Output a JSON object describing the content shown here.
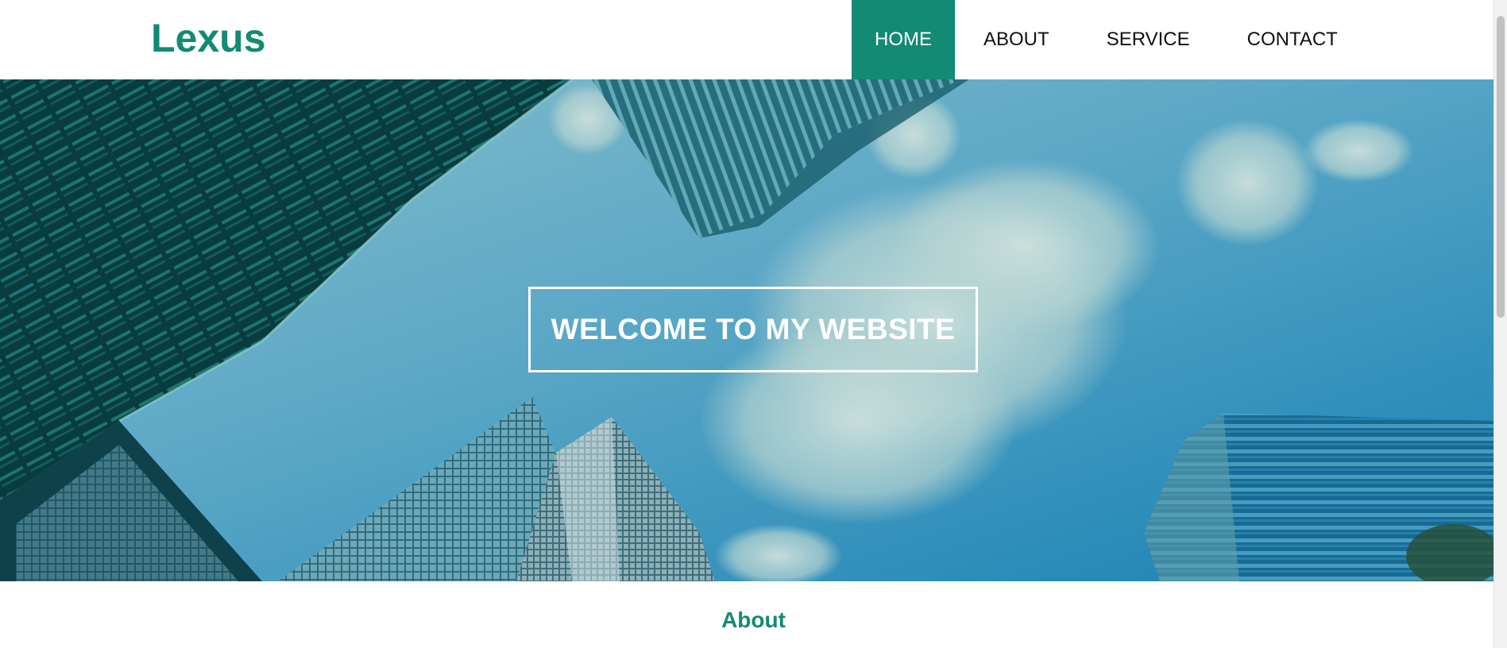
{
  "header": {
    "logo": "Lexus",
    "nav": [
      {
        "label": "HOME",
        "active": true
      },
      {
        "label": "ABOUT",
        "active": false
      },
      {
        "label": "SERVICE",
        "active": false
      },
      {
        "label": "CONTACT",
        "active": false
      }
    ]
  },
  "hero": {
    "welcome": "WELCOME TO MY WEBSITE"
  },
  "about": {
    "heading": "About"
  },
  "colors": {
    "accent": "#138a74",
    "text": "#111111",
    "background": "#ffffff"
  }
}
